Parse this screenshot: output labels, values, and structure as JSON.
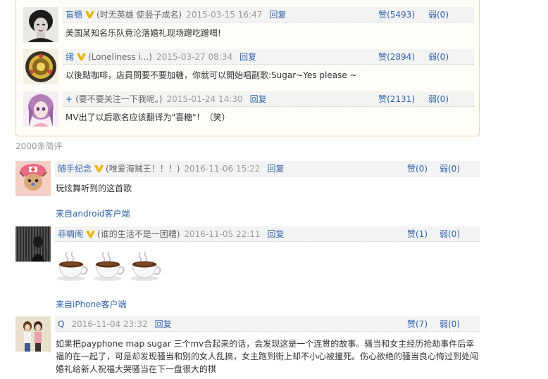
{
  "hot_comments": [
    {
      "user": "盲戆",
      "signature": "(时无英雄 使竖子成名)",
      "time": "2015-03-15 16:47",
      "reply": "回复",
      "likes": "赞(5493)",
      "weak": "弱(0)",
      "text": "美国某知名乐队竟沦落婚礼现场蹭吃蹭喝!"
    },
    {
      "user": "绪",
      "signature": "(Loneliness i...)",
      "time": "2015-03-27 08:34",
      "reply": "回复",
      "likes": "赞(2894)",
      "weak": "弱(0)",
      "text": "以後點咖啡，店員問要不要加糖，你就可以開始唱副歌:Sugar~Yes please ~"
    },
    {
      "user": "+",
      "signature": "(要不要关注一下我呢。)",
      "time": "2015-01-24 14:30",
      "reply": "回复",
      "likes": "赞(2131)",
      "weak": "弱(0)",
      "text": "MV出了以后歌名应该翻译为\"喜糖\"！（笑）"
    }
  ],
  "short_comments_title": "2000条简评",
  "short_comments": [
    {
      "user": "随手纪念",
      "signature": "(唯爱海贼王！！！)",
      "time": "2016-11-06 15:22",
      "reply": "回复",
      "likes": "赞(0)",
      "weak": "弱(0)",
      "text": "玩炫舞听到的这首歌",
      "from": "来自android客户端"
    },
    {
      "user": "菲啁闹",
      "signature": "(谁的生活不是一团糟)",
      "time": "2016-11-05 22:11",
      "reply": "回复",
      "likes": "赞(1)",
      "weak": "弱(0)",
      "from": "来自iPhone客户端"
    },
    {
      "user": "Q",
      "time": "2016-11-04 23:32",
      "reply": "回复",
      "likes": "赞(7)",
      "weak": "弱(0)",
      "text": "如果把payphone map sugar 三个mv合起来的话，会发现这是一个连贯的故事。骚当和女主经历抢劫事件后幸福的在一起了，可是却发现骚当和别的女人乱搞，女主跑到街上却不小心被撞死。伤心欲绝的骚当良心悔过到处闯婚礼给新人祝福大哭骚当在下一盘很大的棋"
    }
  ],
  "colors": {
    "link": "#2f62a8",
    "hot_border": "#f2cfa8",
    "vip_badge": "#e8b400"
  }
}
